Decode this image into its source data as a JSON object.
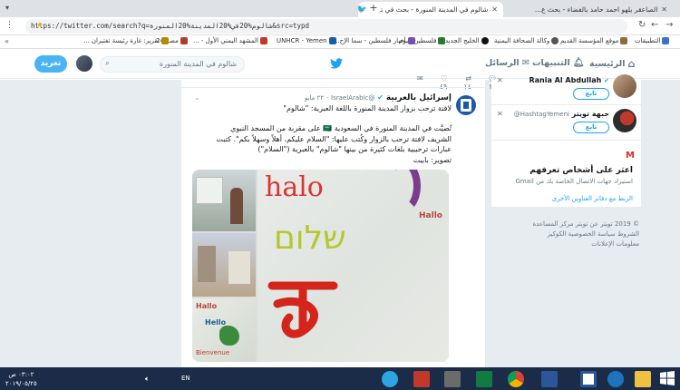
{
  "browser": {
    "tabs": [
      {
        "title": "الصاعقر يلهو احمد حامد بالفضاء - بحث ع..."
      },
      {
        "title": "شالوم في المدينة المنورة - بحث في تويتر"
      }
    ],
    "new_tab": "+",
    "url": "https://twitter.com/search?q=شالوم%20في%20المدينة%20المنورة&src=typd",
    "bookmarks": [
      {
        "label": "التطبيقات",
        "color": "#3b6fd4"
      },
      {
        "label": "موقع المؤسسة القديم",
        "color": "#8a6d3b"
      },
      {
        "label": "وكالة الصحافة اليمنية",
        "color": "#555555"
      },
      {
        "label": "الخليج الجديد",
        "color": "#111111"
      },
      {
        "label": "فلسطين اليوم",
        "color": "#2b7a2b"
      },
      {
        "label": "أخبار فلسطين - سما الإخ...",
        "color": "#7a4fb0"
      },
      {
        "label": "UNHCR - Yemen",
        "color": "#1b5ea8"
      },
      {
        "label": "المشهد اليمني الأول - ...",
        "color": "#c0392b"
      },
      {
        "label": "مصر 24",
        "color": "#b03a2e"
      },
      {
        "label": "تقرير: غارة رئيسة تغتيران ...",
        "color": "#b58a00"
      }
    ]
  },
  "twitter": {
    "nav": {
      "home": "الرئيسية",
      "notifications": "التنبيهات",
      "messages": "الرسائل"
    },
    "search_placeholder": "شالوم في المدينة المنورة",
    "tweet_button": "تغريد",
    "top_counts": {
      "replies": "٢٤",
      "retweets": "١٤",
      "likes": "٤٩"
    },
    "tweet": {
      "author": "إسرائيل بالعربية",
      "handle": "@IsraelArabic",
      "date": "٢٢ مايو",
      "subtitle": "لافتة ترحب بزوار المدينة المنورة باللغة العبرية: \"شالوم\"",
      "body_line1": "تُصيَّت في المدينة المنورة في السعودية 🇸🇦 على مقربة من المسجد النبوي",
      "body_line2": "الشريف لافتة ترحب بالزوار وكُتب عليها: \"السلام عليكم، أهلاً وسهلاً بكم\". كتبت",
      "body_line3": "عبارات ترحيبية بلغات كثيرة من بينها \"شالوم\" بالعبرية (\"السلام\")",
      "body_line4": "تصوير: بابيت",
      "image_text_hebrew": "שלום",
      "image_text_halo": "halo",
      "image_text_hallo": "Hallo",
      "image_text_hello": "Hello",
      "image_text_bienvenue": "Bienvenue"
    },
    "suggestions": [
      {
        "name": "Rania Al Abdullah",
        "handle": "",
        "button": "تابع"
      },
      {
        "name": "جبهة تويتر",
        "handle": "HashtagYemeni@",
        "button": "تابع"
      }
    ],
    "find_friends": {
      "title": "اعثر على أشخاص تعرفهم",
      "subtitle": "استيراد جهات الاتصال الخاصة بك من Gmail",
      "link": "الربط مع دفاتر العناوين الأخرى"
    },
    "footer": {
      "line1": "© 2019 تويتر   عن تويتر   مركز المساعدة",
      "line2": "الشروط   سياسة الخصوصية   الكوكيز",
      "line3": "معلومات الإعلانات"
    }
  },
  "taskbar": {
    "time": "٠٣:٠٢ ص",
    "date": "٢٠١٩/٠٥/٢٥",
    "lang": "EN"
  },
  "colors": {
    "twitter_blue": "#1da1f2",
    "taskbar": "#1b2c48",
    "page_bg": "#e6ecf0"
  }
}
